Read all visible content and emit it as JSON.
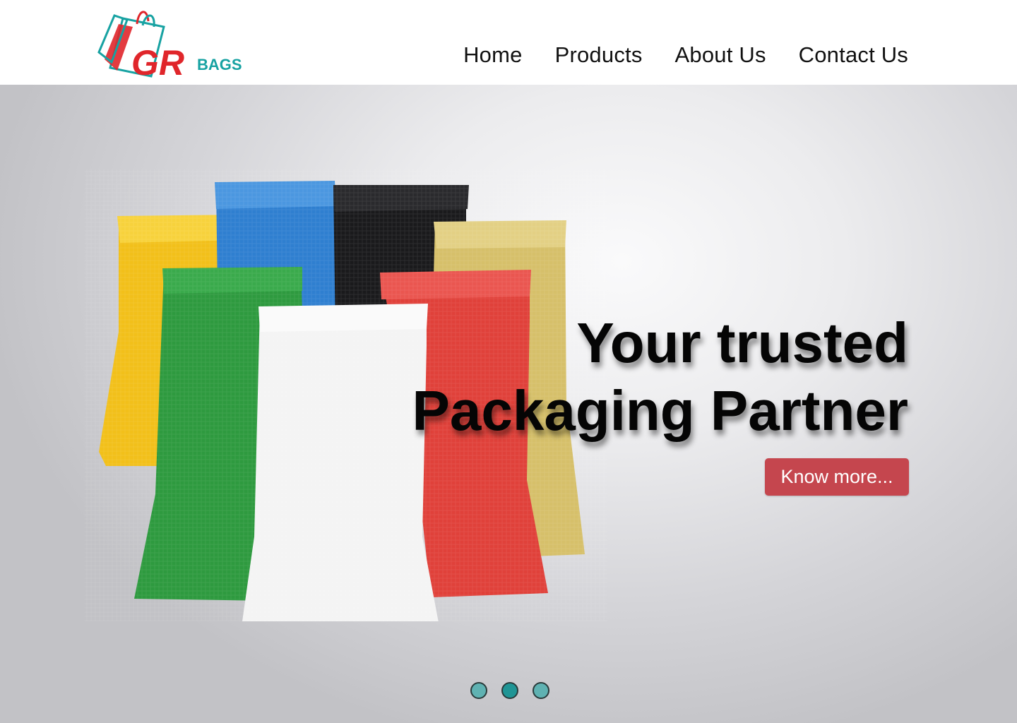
{
  "brand": {
    "logo_text": "GR",
    "logo_sub": "BAGS",
    "colors": {
      "teal": "#17a2a2",
      "red": "#e0262b"
    }
  },
  "nav": {
    "items": [
      {
        "label": "Home"
      },
      {
        "label": "Products"
      },
      {
        "label": "About Us"
      },
      {
        "label": "Contact Us"
      }
    ]
  },
  "hero": {
    "headline_line1": "Your trusted",
    "headline_line2": "Packaging Partner",
    "cta_label": "Know more...",
    "cta_color": "#c5464e",
    "image": "woven-sacks-image",
    "bag_colors": [
      "#f2c01a",
      "#2f7fd0",
      "#1a1a1c",
      "#d6c06a",
      "#2e9a3f",
      "#e0413a",
      "#f4f4f4"
    ]
  },
  "carousel": {
    "slide_count": 3,
    "active_index": 1
  }
}
